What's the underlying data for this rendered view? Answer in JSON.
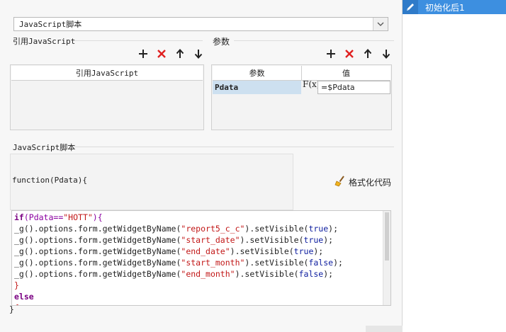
{
  "script_type": {
    "selected": "JavaScript脚本"
  },
  "ref_section": {
    "title": "引用JavaScript",
    "col_header": "引用JavaScript"
  },
  "param_section": {
    "title": "参数",
    "col_name": "参数",
    "col_value": "值",
    "rows": [
      {
        "name": "Pdata",
        "fx": "F(x)",
        "value": "=$Pdata"
      }
    ]
  },
  "script_section": {
    "title": "JavaScript脚本",
    "function_header": "function(Pdata){",
    "format_button": "格式化代码",
    "closing": "}"
  },
  "code": {
    "line1": [
      "if",
      "(Pdata==",
      "\"HOTT\"",
      "){"
    ],
    "calls": [
      {
        "arg": "\"report5_c_c\"",
        "bool": "true"
      },
      {
        "arg": "\"start_date\"",
        "bool": "true"
      },
      {
        "arg": "\"end_date\"",
        "bool": "true"
      },
      {
        "arg": "\"start_month\"",
        "bool": "false"
      },
      {
        "arg": "\"end_month\"",
        "bool": "false"
      }
    ],
    "prefix": "_g().options.form.getWidgetByName(",
    "mid": ").setVisible(",
    "suffix": ");",
    "close_brace": "}",
    "else_kw": "else",
    "open_brace": "{"
  },
  "sidebar": {
    "items": [
      {
        "label": "初始化后1"
      }
    ]
  },
  "colors": {
    "accent": "#3d8fe0",
    "selection": "#cde0f0",
    "delete": "#e02020"
  },
  "icons": [
    "add-icon",
    "delete-icon",
    "move-up-icon",
    "move-down-icon",
    "broom-icon",
    "edit-icon",
    "chevron-down-icon"
  ]
}
